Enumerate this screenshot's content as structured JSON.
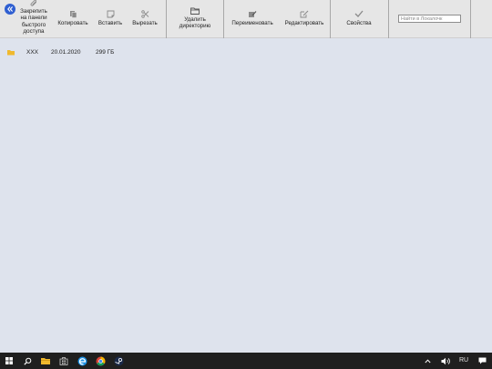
{
  "toolbar": {
    "pin": "Закрепить на панели быстрого доступа",
    "copy": "Копировать",
    "paste": "Вставить",
    "cut": "Вырезать",
    "delete_dir": "Удалить директорию",
    "rename": "Переименовать",
    "edit": "Редактировать",
    "properties": "Свойства",
    "search_placeholder": "Найти в Локалочк"
  },
  "files": [
    {
      "name": "XXX",
      "date": "20.01.2020",
      "size": "299 ГБ"
    }
  ],
  "taskbar": {
    "language": "RU"
  },
  "colors": {
    "content_bg": "#dee3ed",
    "ribbon_bg": "#e6e6e6",
    "taskbar_bg": "#1f1f1f",
    "back_button": "#2f5fd1",
    "folder": "#f0b92e"
  },
  "icons": [
    "back-icon",
    "paperclip-icon",
    "copy-icon",
    "paste-icon",
    "scissors-icon",
    "folder-icon",
    "rename-icon",
    "edit-icon",
    "checkmark-icon",
    "windows-start-icon",
    "search-icon",
    "file-explorer-icon",
    "store-icon",
    "edge-icon",
    "chrome-icon",
    "steam-icon",
    "chevron-up-icon",
    "volume-icon",
    "notifications-icon"
  ]
}
